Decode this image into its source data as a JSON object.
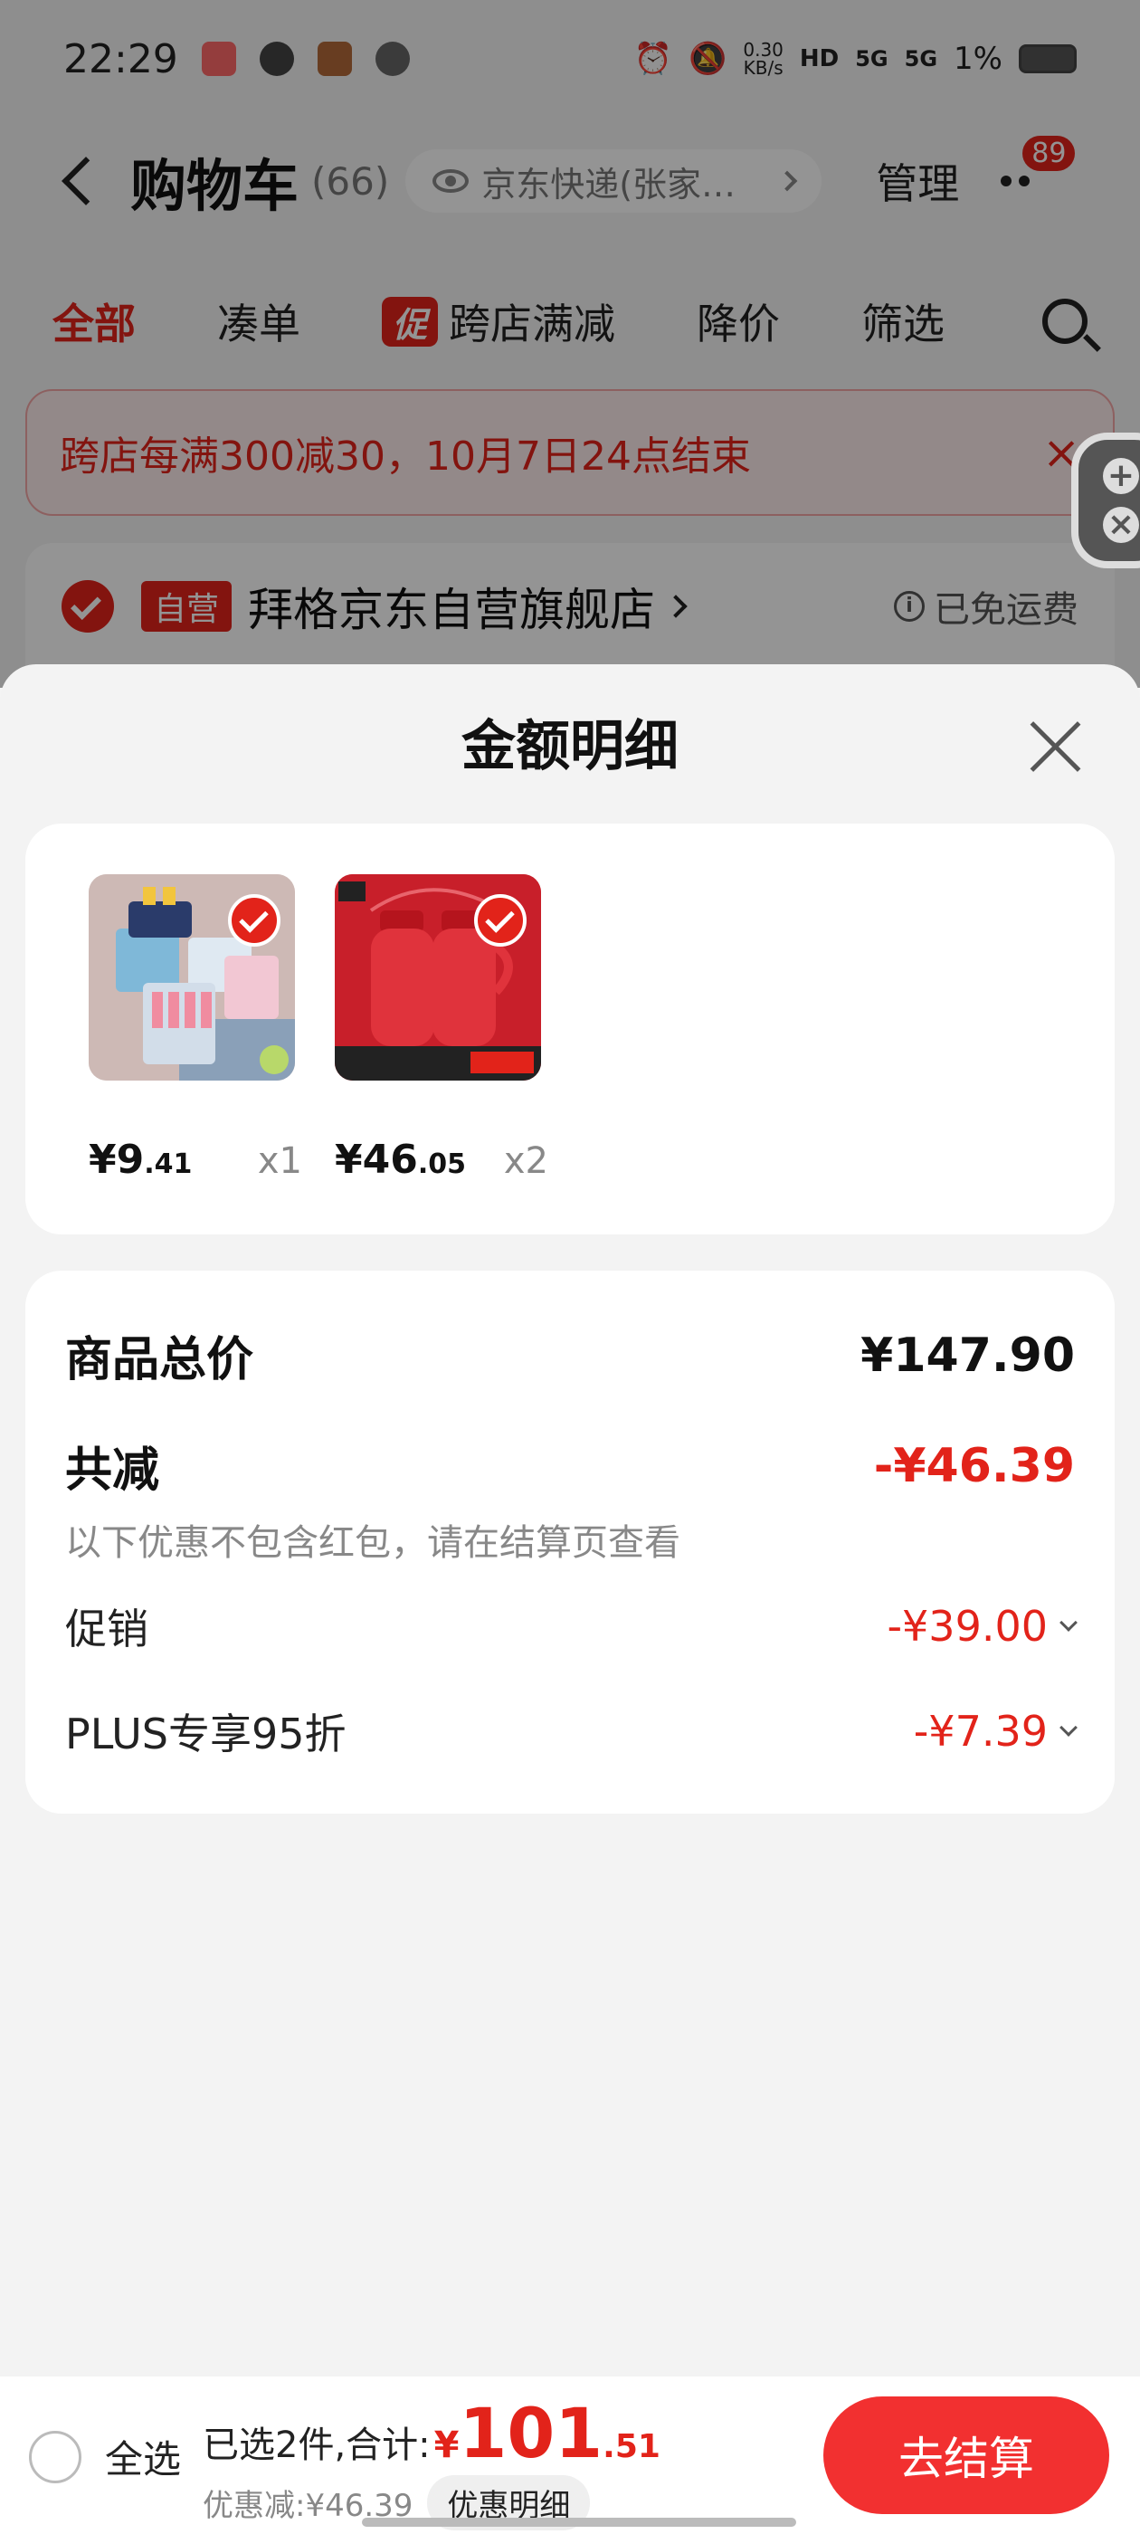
{
  "status_bar": {
    "time": "22:29",
    "net_speed": "0.30",
    "net_unit": "KB/s",
    "hd": "HD",
    "signal1": "5G",
    "signal2": "5G",
    "battery": "1%"
  },
  "navbar": {
    "title": "购物车",
    "count": "(66)",
    "address": "京东快递(张家…",
    "manage": "管理",
    "badge": "89"
  },
  "tabs": [
    {
      "label": "全部"
    },
    {
      "label": "凑单"
    },
    {
      "label": "跨店满减",
      "tag": "促"
    },
    {
      "label": "降价"
    },
    {
      "label": "筛选"
    }
  ],
  "banner": {
    "text": "跨店每满300减30，10月7日24点结束",
    "close": "×"
  },
  "store": {
    "tag": "自营",
    "name": "拜格京东自营旗舰店",
    "shipping": "已免运费",
    "info": "i"
  },
  "sheet": {
    "title": "金额明细",
    "products": [
      {
        "price_int": "¥9",
        "price_dec": ".41",
        "qty": "x1"
      },
      {
        "price_int": "¥46",
        "price_dec": ".05",
        "qty": "x2"
      }
    ],
    "summary": {
      "total_label": "商品总价",
      "total_value": "¥147.90",
      "reduce_label": "共减",
      "reduce_value": "-¥46.39",
      "note": "以下优惠不包含红包，请在结算页查看",
      "promo_label": "促销",
      "promo_value": "-¥39.00",
      "plus_label": "PLUS专享95折",
      "plus_value": "-¥7.39"
    }
  },
  "bottom": {
    "select_all": "全选",
    "selected_label": "已选2件,合计:",
    "currency": "¥",
    "total_int": "101",
    "total_dec": ".51",
    "discount": "优惠减:¥46.39",
    "detail": "优惠明细",
    "checkout": "去结算"
  },
  "colors": {
    "accent": "#e2231a",
    "checkout": "#f23030"
  }
}
